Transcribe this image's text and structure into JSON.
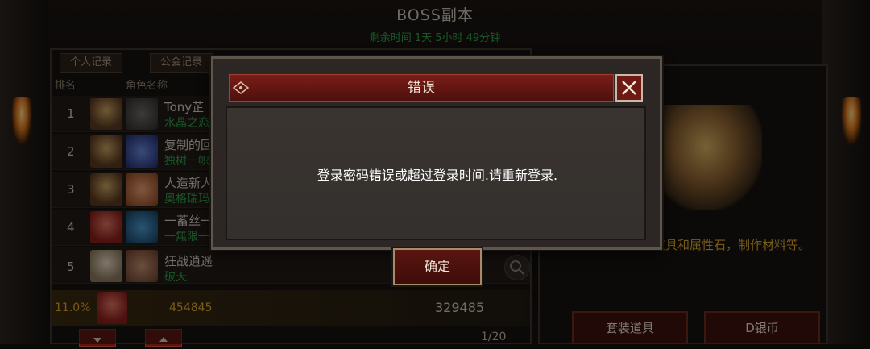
{
  "screen": {
    "title": "BOSS副本",
    "remaining_time": "剩余时间 1天 5小时 49分钟"
  },
  "tabs": [
    "个人记录",
    "公会记录"
  ],
  "columns": [
    "排名",
    "角色名称"
  ],
  "ranking": [
    {
      "rank": "1",
      "name": "Tony芷",
      "guild": "水晶之恋",
      "emblem": "lion-emblem-icon"
    },
    {
      "rank": "2",
      "name": "复制的回忆",
      "guild": "独树一帜",
      "emblem": "dragon-emblem-icon"
    },
    {
      "rank": "3",
      "name": "人造新人",
      "guild": "奥格瑞玛",
      "emblem": "crossed-swords-emblem-icon"
    },
    {
      "rank": "4",
      "name": "一蓄丝一",
      "guild": "一無限一",
      "emblem": "wheel-emblem-icon"
    },
    {
      "rank": "5",
      "name": "狂战逍遥",
      "guild": "破天",
      "emblem": "winged-emblem-icon"
    }
  ],
  "self_record": {
    "percent": "11.0%",
    "score": "454845",
    "damage": "329485"
  },
  "pagination": {
    "page": "1/20"
  },
  "rewards": {
    "description": "可获得活动套装道具和属性石，制作材料等。",
    "buttons": [
      "套装道具",
      "D银币"
    ]
  },
  "dialog": {
    "title": "错误",
    "message": "登录密码错误或超过登录时间.请重新登录.",
    "confirm_label": "确定",
    "close_icon": "close-icon"
  },
  "colors": {
    "guild_green": "#2fa34a",
    "gold": "#d9a62a",
    "dialog_title_red": "#7a1d18"
  }
}
